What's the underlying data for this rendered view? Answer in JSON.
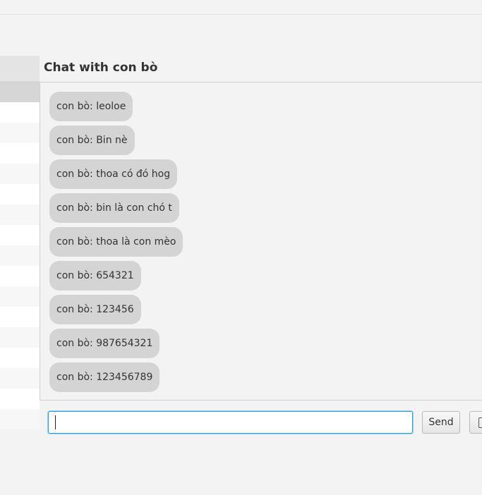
{
  "chat": {
    "title": "Chat with con bò",
    "messages": [
      "con bò: leoloe",
      "con bò: Bin nè",
      "con bò: thoa có đó hog",
      "con bò: bin là con chó t",
      "con bò: thoa là con mèo",
      "con bò: 654321",
      "con bò: 123456",
      "con bò: 987654321",
      "con bò: 123456789"
    ]
  },
  "composer": {
    "input_value": "",
    "send_label": "Send"
  },
  "icons": {
    "extra_button": "attach-icon"
  }
}
